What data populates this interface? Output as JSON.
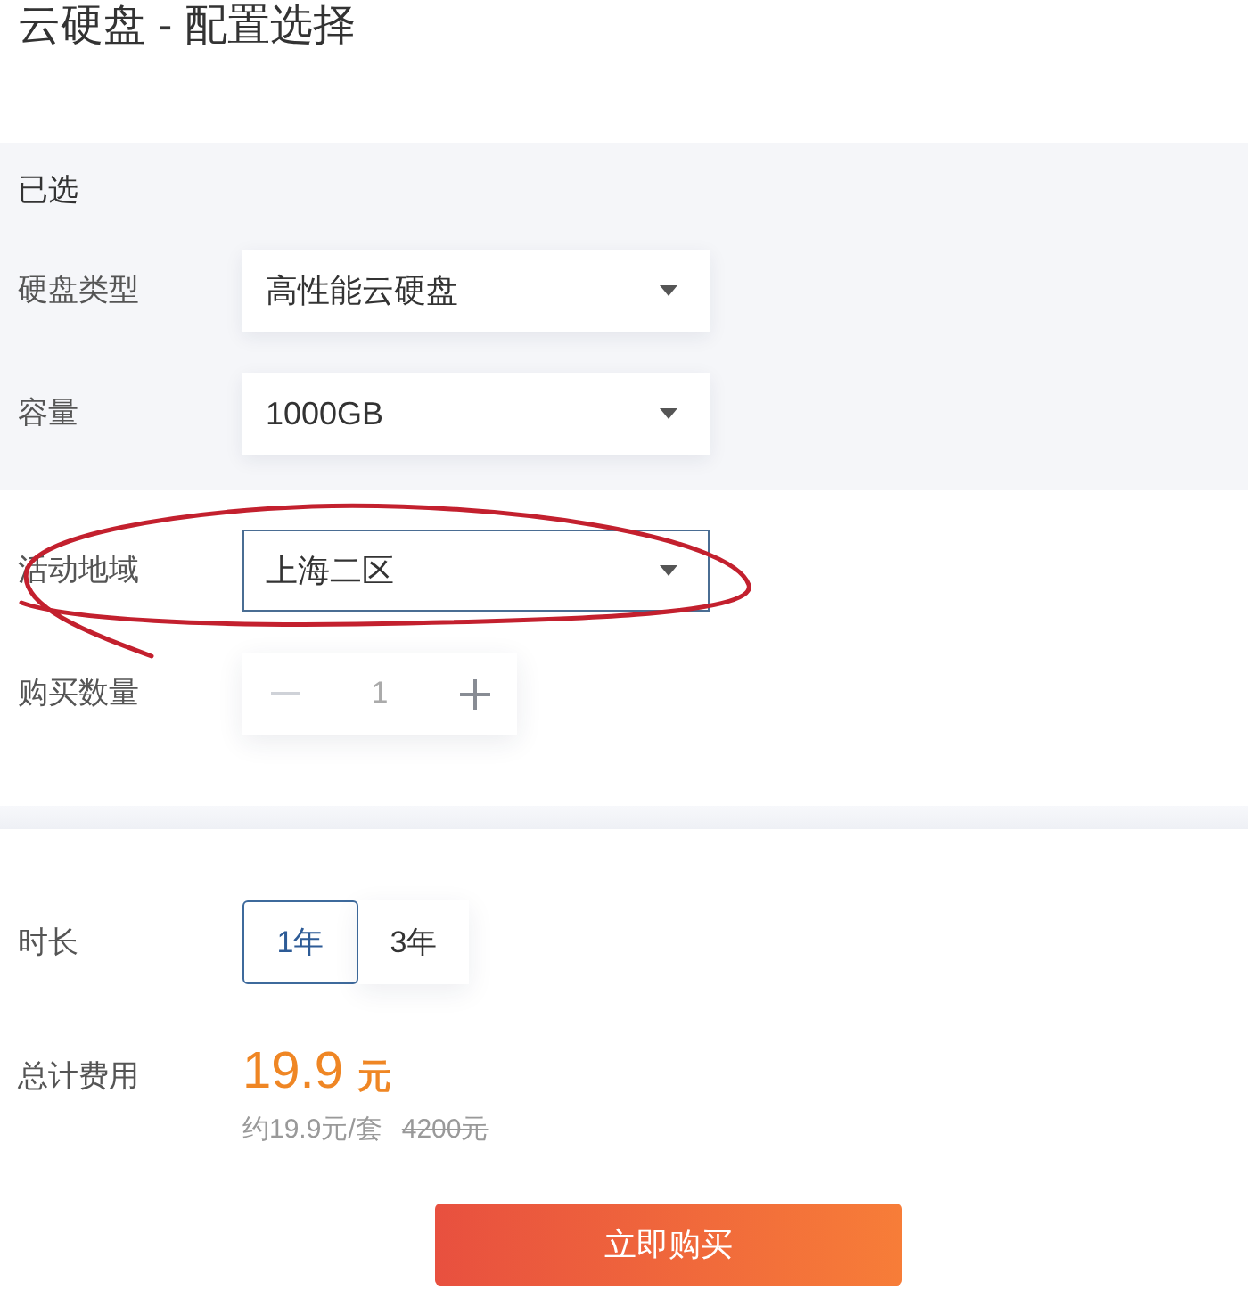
{
  "title": "云硬盘 - 配置选择",
  "selected_section": {
    "heading": "已选",
    "fields": [
      {
        "kind": "select",
        "label": "硬盘类型",
        "value": "高性能云硬盘",
        "focused": false,
        "circled": false
      },
      {
        "kind": "select",
        "label": "容量",
        "value": "1000GB",
        "focused": false,
        "circled": false
      }
    ]
  },
  "config_section": {
    "fields": [
      {
        "kind": "select",
        "label": "活动地域",
        "value": "上海二区",
        "focused": true,
        "circled": true
      },
      {
        "kind": "stepper",
        "label": "购买数量",
        "value": "1",
        "decrement": {
          "disabled": true
        },
        "increment": {
          "disabled": false
        },
        "circled": false
      }
    ]
  },
  "duration": {
    "label": "时长",
    "options": [
      {
        "label": "1年",
        "selected": true
      },
      {
        "label": "3年",
        "selected": false
      }
    ]
  },
  "total": {
    "label": "总计费用",
    "amount": "19.9",
    "unit": "元",
    "unit_price": "约19.9元/套",
    "original_price": "4200元"
  },
  "buy_button": {
    "label": "立即购买"
  }
}
